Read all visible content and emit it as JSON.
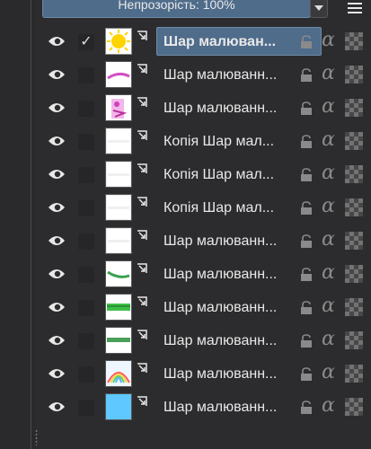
{
  "panel": {
    "opacity_label": "Непрозорість:  100%",
    "menu_icon": "hamburger-icon",
    "dropdown_icon": "chevron-down-icon"
  },
  "layers": [
    {
      "name": "Шар малюван...",
      "visible": true,
      "checked": true,
      "selected": true,
      "thumb": "sun"
    },
    {
      "name": "Шар малюванн...",
      "visible": true,
      "checked": false,
      "selected": false,
      "thumb": "pink-line"
    },
    {
      "name": "Шар малюванн...",
      "visible": true,
      "checked": false,
      "selected": false,
      "thumb": "pink-figure"
    },
    {
      "name": "Копія Шар мал...",
      "visible": true,
      "checked": false,
      "selected": false,
      "thumb": "white-line"
    },
    {
      "name": "Копія Шар мал...",
      "visible": true,
      "checked": false,
      "selected": false,
      "thumb": "white-line"
    },
    {
      "name": "Копія Шар мал...",
      "visible": true,
      "checked": false,
      "selected": false,
      "thumb": "white-line"
    },
    {
      "name": "Шар малюванн...",
      "visible": true,
      "checked": false,
      "selected": false,
      "thumb": "white-line"
    },
    {
      "name": "Шар малюванн...",
      "visible": true,
      "checked": false,
      "selected": false,
      "thumb": "green-stroke"
    },
    {
      "name": "Шар малюванн...",
      "visible": true,
      "checked": false,
      "selected": false,
      "thumb": "green-bar"
    },
    {
      "name": "Шар малюванн...",
      "visible": true,
      "checked": false,
      "selected": false,
      "thumb": "green-band"
    },
    {
      "name": "Шар малюванн...",
      "visible": true,
      "checked": false,
      "selected": false,
      "thumb": "rainbow"
    },
    {
      "name": "Шар малюванн...",
      "visible": true,
      "checked": false,
      "selected": false,
      "thumb": "sky"
    }
  ],
  "colors": {
    "accent": "#4f6c8b",
    "panel_bg": "#2c2c2e"
  },
  "icons": {
    "eye": "eye-icon",
    "link": "clipping-mask-icon",
    "lock": "lock-icon",
    "alpha": "alpha-lock-icon",
    "blend": "blend-mode-icon"
  }
}
